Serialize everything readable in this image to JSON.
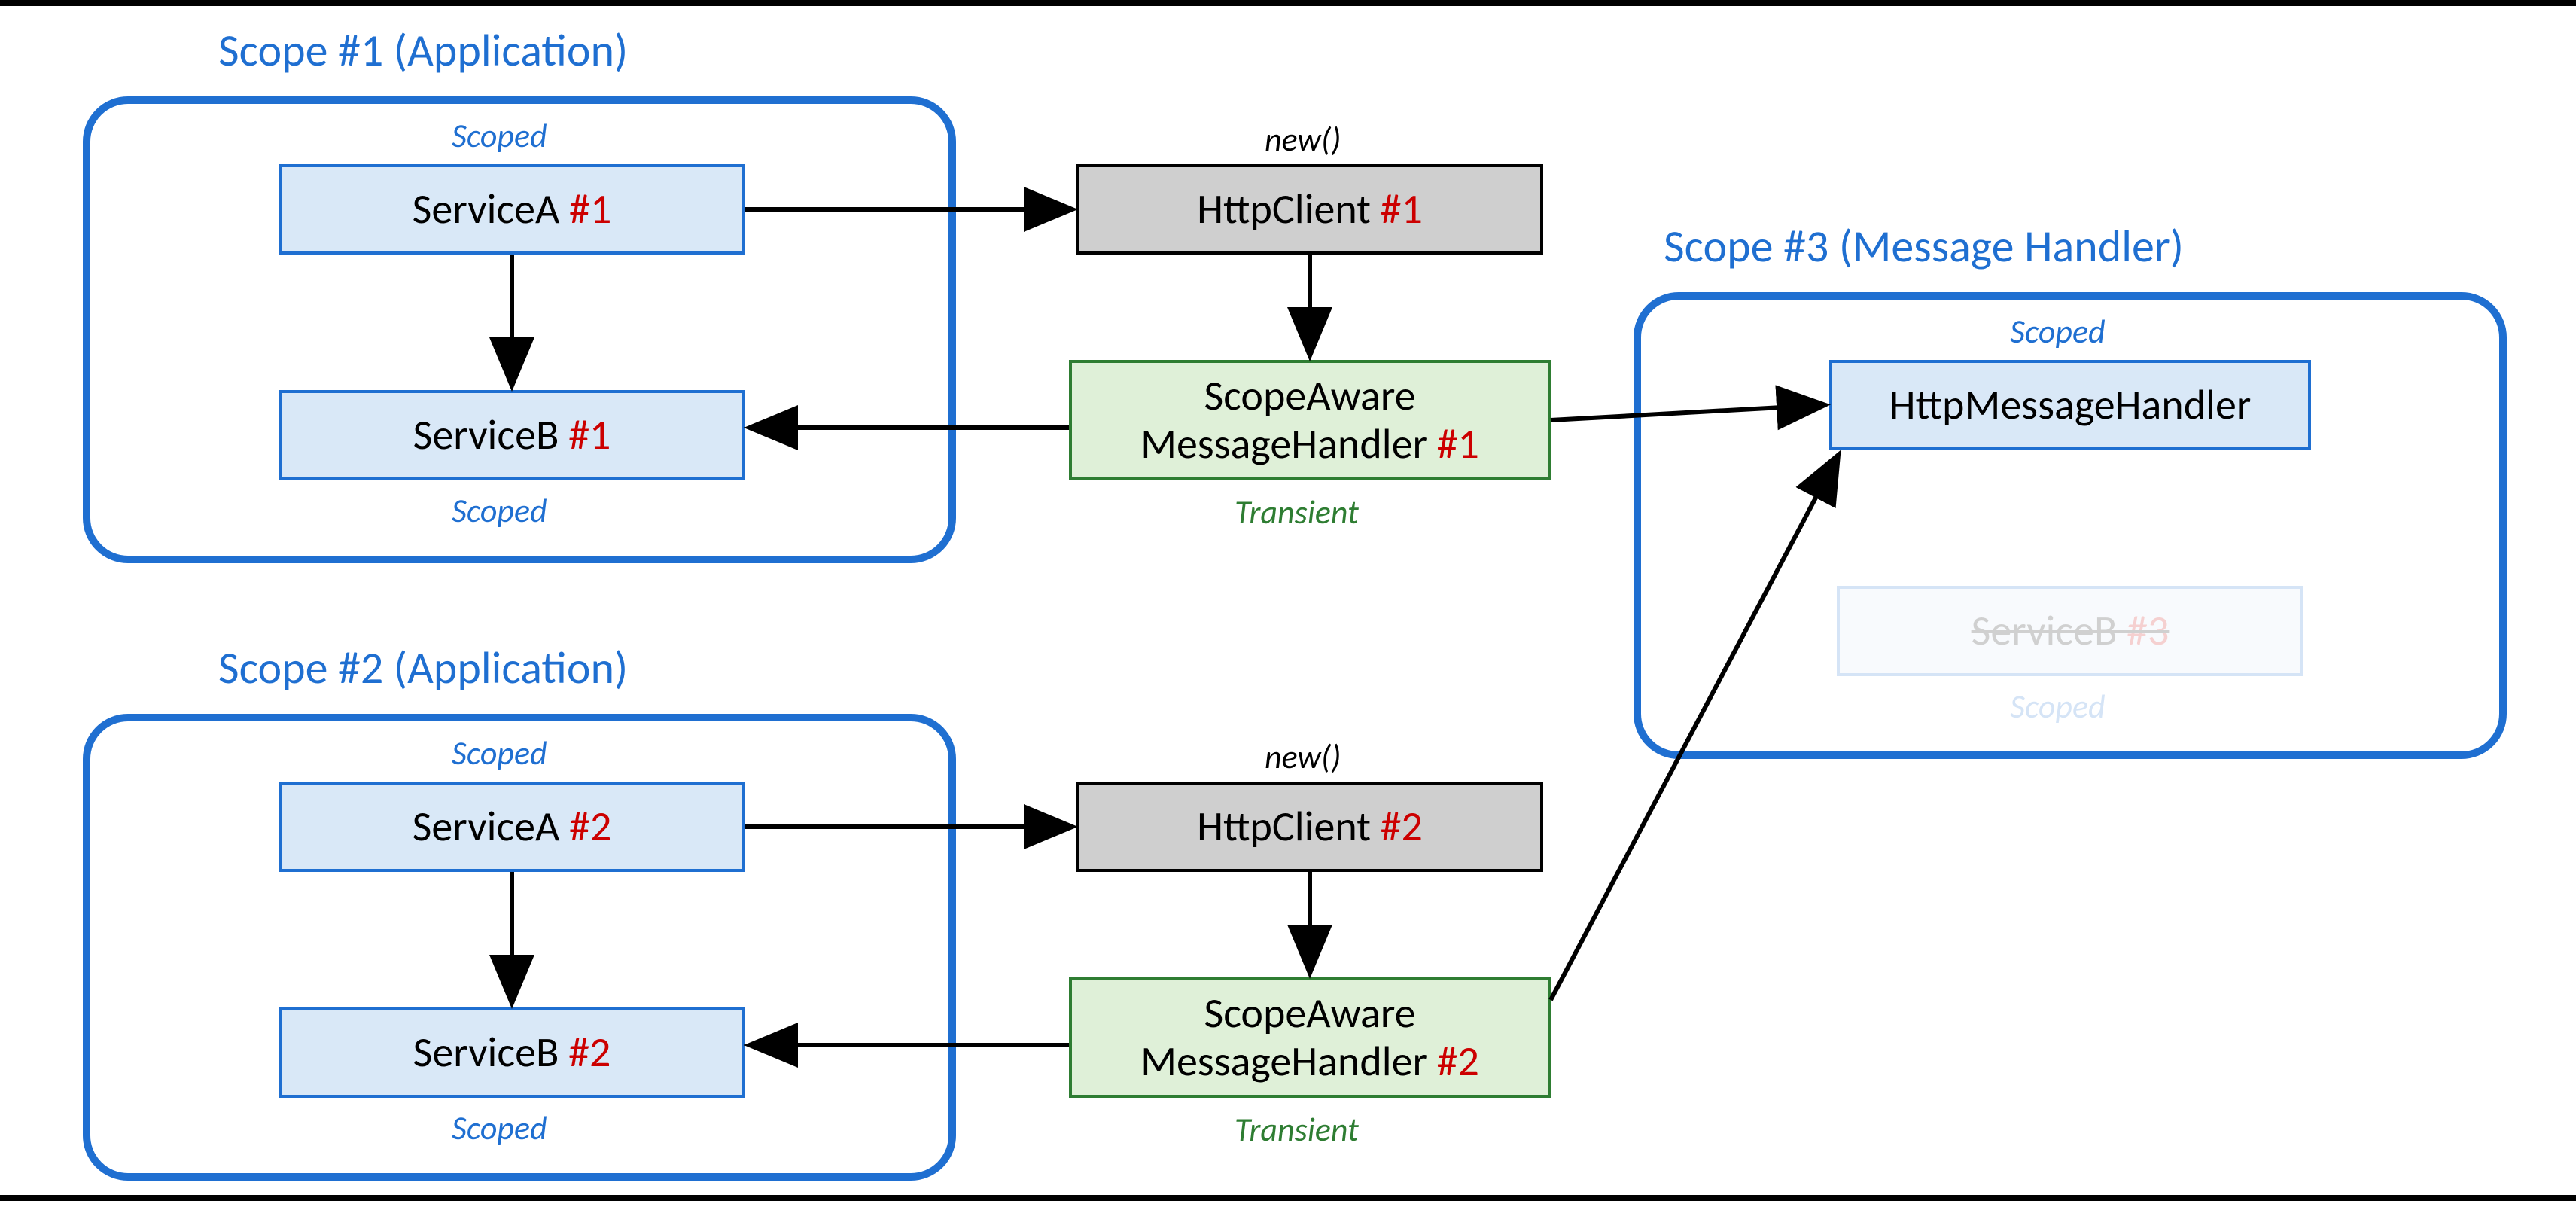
{
  "scopes": {
    "s1": {
      "title": "Scope #1 (Application)"
    },
    "s2": {
      "title": "Scope #2 (Application)"
    },
    "s3": {
      "title": "Scope #3 (Message Handler)"
    }
  },
  "lifetimes": {
    "scoped": "Scoped",
    "transient": "Transient",
    "new": "new()"
  },
  "boxes": {
    "serviceA1": {
      "text": "ServiceA ",
      "tag": "#1"
    },
    "serviceB1": {
      "text": "ServiceB ",
      "tag": "#1"
    },
    "serviceA2": {
      "text": "ServiceA ",
      "tag": "#2"
    },
    "serviceB2": {
      "text": "ServiceB ",
      "tag": "#2"
    },
    "httpClient1": {
      "text": "HttpClient ",
      "tag": "#1"
    },
    "httpClient2": {
      "text": "HttpClient ",
      "tag": "#2"
    },
    "handler1": {
      "line1": "ScopeAware",
      "line2": "MessageHandler ",
      "tag": "#1"
    },
    "handler2": {
      "line1": "ScopeAware",
      "line2": "MessageHandler ",
      "tag": "#2"
    },
    "httpMsgH": {
      "text": "HttpMessageHandler"
    },
    "serviceB3": {
      "text": "ServiceB ",
      "tag": "#3"
    }
  },
  "chart_data": {
    "type": "diagram",
    "scopes": [
      {
        "id": "scope1",
        "label": "Scope #1 (Application)",
        "contents": [
          {
            "id": "ServiceA#1",
            "lifetime": "Scoped"
          },
          {
            "id": "ServiceB#1",
            "lifetime": "Scoped"
          }
        ]
      },
      {
        "id": "scope2",
        "label": "Scope #2 (Application)",
        "contents": [
          {
            "id": "ServiceA#2",
            "lifetime": "Scoped"
          },
          {
            "id": "ServiceB#2",
            "lifetime": "Scoped"
          }
        ]
      },
      {
        "id": "scope3",
        "label": "Scope #3 (Message Handler)",
        "contents": [
          {
            "id": "HttpMessageHandler",
            "lifetime": "Scoped"
          },
          {
            "id": "ServiceB#3",
            "lifetime": "Scoped",
            "unused": true
          }
        ]
      }
    ],
    "free_nodes": [
      {
        "id": "HttpClient#1",
        "lifetime": "new()"
      },
      {
        "id": "HttpClient#2",
        "lifetime": "new()"
      },
      {
        "id": "ScopeAwareMessageHandler#1",
        "lifetime": "Transient"
      },
      {
        "id": "ScopeAwareMessageHandler#2",
        "lifetime": "Transient"
      }
    ],
    "edges": [
      [
        "ServiceA#1",
        "HttpClient#1"
      ],
      [
        "ServiceA#1",
        "ServiceB#1"
      ],
      [
        "HttpClient#1",
        "ScopeAwareMessageHandler#1"
      ],
      [
        "ScopeAwareMessageHandler#1",
        "ServiceB#1"
      ],
      [
        "ScopeAwareMessageHandler#1",
        "HttpMessageHandler"
      ],
      [
        "ServiceA#2",
        "HttpClient#2"
      ],
      [
        "ServiceA#2",
        "ServiceB#2"
      ],
      [
        "HttpClient#2",
        "ScopeAwareMessageHandler#2"
      ],
      [
        "ScopeAwareMessageHandler#2",
        "ServiceB#2"
      ],
      [
        "ScopeAwareMessageHandler#2",
        "HttpMessageHandler"
      ]
    ]
  }
}
